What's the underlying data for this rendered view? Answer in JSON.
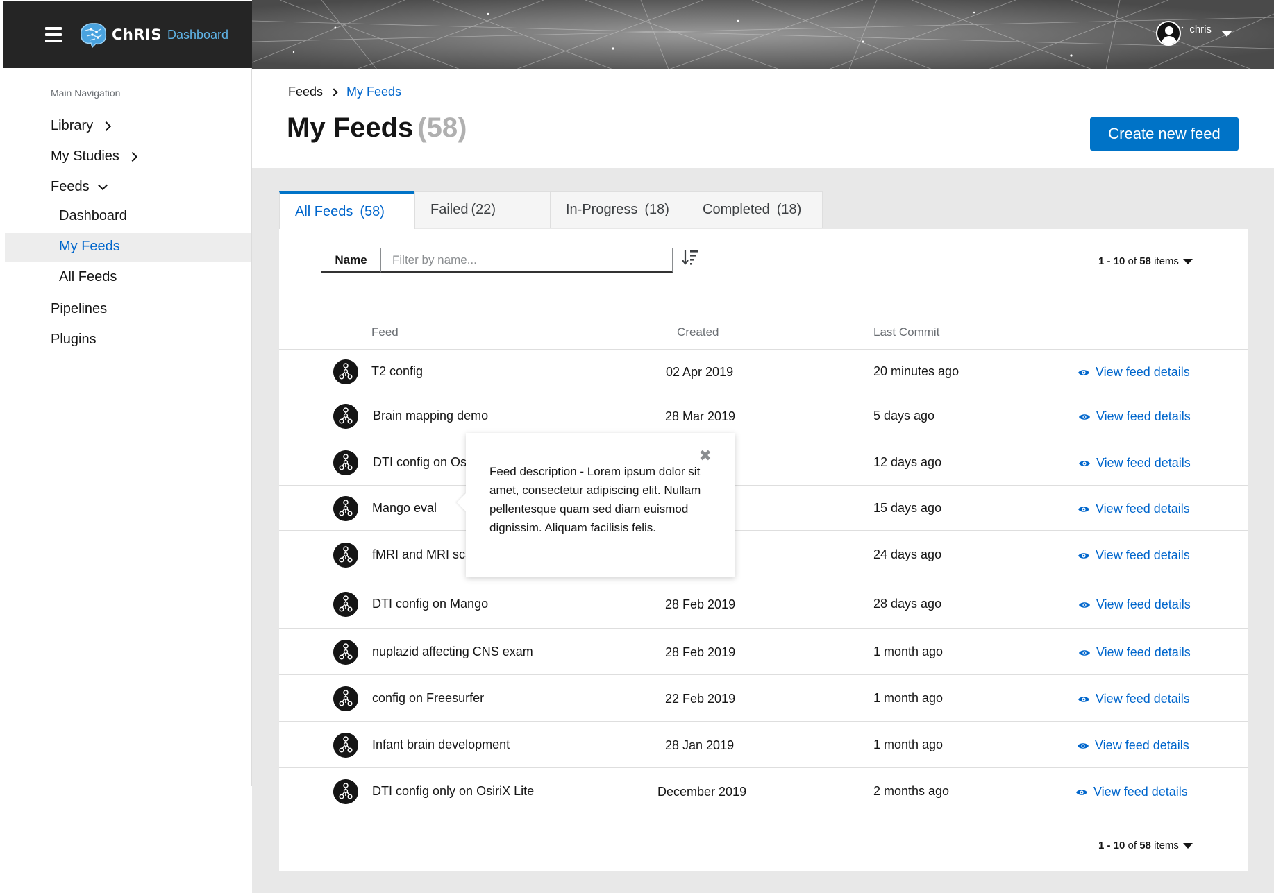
{
  "app": {
    "brand": "ChRIS",
    "brand_sub": "Dashboard"
  },
  "user": {
    "name": "chris"
  },
  "sidebar": {
    "heading": "Main Navigation",
    "items": [
      {
        "label": "Library"
      },
      {
        "label": "My Studies"
      },
      {
        "label": "Feeds"
      },
      {
        "label": "Pipelines"
      },
      {
        "label": "Plugins"
      }
    ],
    "feeds_sub": [
      {
        "label": "Dashboard"
      },
      {
        "label": "My Feeds"
      },
      {
        "label": "All Feeds"
      }
    ]
  },
  "breadcrumb": {
    "parent": "Feeds",
    "current": "My Feeds"
  },
  "page": {
    "title": "My Feeds",
    "count": "(58)",
    "create_button": "Create new feed"
  },
  "tabs": [
    {
      "label": "All Feeds",
      "count": "(58)"
    },
    {
      "label": "Failed",
      "count": "(22)"
    },
    {
      "label": "In-Progress",
      "count": "(18)"
    },
    {
      "label": "Completed",
      "count": "(18)"
    }
  ],
  "filter": {
    "label": "Name",
    "placeholder": "Filter by name..."
  },
  "pager": {
    "range": "1 - 10",
    "of": "of",
    "total": "58",
    "unit": "items"
  },
  "table": {
    "columns": {
      "feed": "Feed",
      "created": "Created",
      "last_commit": "Last Commit"
    },
    "view_label": "View feed details",
    "rows": [
      {
        "name": "T2 config",
        "created": "02 Apr 2019",
        "commit": "20 minutes ago"
      },
      {
        "name": "Brain mapping demo",
        "created": "28 Mar 2019",
        "commit": "5 days ago"
      },
      {
        "name": "DTI config on Osi",
        "created": "",
        "commit": "12 days ago"
      },
      {
        "name": "Mango eval",
        "created": "",
        "commit": "15 days ago"
      },
      {
        "name": "fMRI and MRI sca",
        "created": "",
        "commit": "24 days ago"
      },
      {
        "name": "DTI config on Mango",
        "created": "28 Feb 2019",
        "commit": "28 days ago"
      },
      {
        "name": "nuplazid affecting CNS exam",
        "created": "28 Feb 2019",
        "commit": "1 month ago"
      },
      {
        "name": "config on Freesurfer",
        "created": "22 Feb 2019",
        "commit": "1 month ago"
      },
      {
        "name": "Infant brain development",
        "created": "28 Jan 2019",
        "commit": "1 month ago"
      },
      {
        "name": "DTI config only on OsiriX Lite",
        "created": "December 2019",
        "commit": "2 months ago"
      }
    ]
  },
  "popover": {
    "text": "Feed description - Lorem ipsum dolor sit amet, consectetur adipiscing elit. Nullam pellentesque quam sed diam euismod dignissim. Aliquam facilisis felis.",
    "close": "✖"
  },
  "colors": {
    "accent": "#0073c7",
    "link": "#0066cc",
    "brand_bar": "#252525"
  }
}
